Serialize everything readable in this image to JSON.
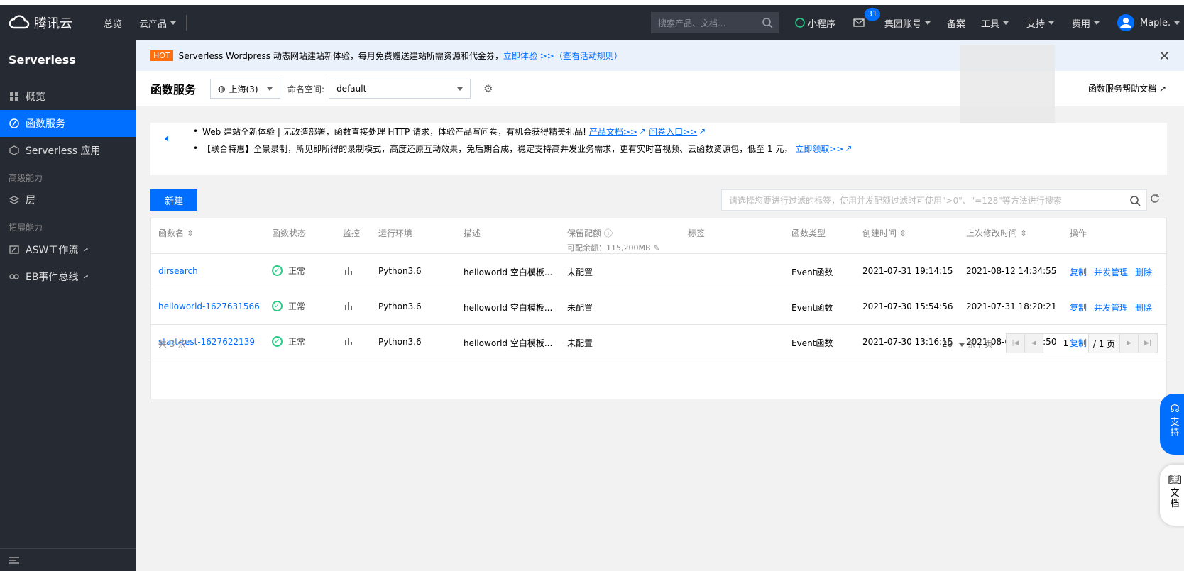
{
  "topbar": {
    "logo_text": "腾讯云",
    "nav": [
      "总览",
      "云产品"
    ],
    "search_placeholder": "搜索产品、文档...",
    "mini_program": "小程序",
    "mail_count": "31",
    "group_account": "集团账号",
    "beian": "备案",
    "tools": "工具",
    "support": "支持",
    "billing": "费用",
    "user": "Maple."
  },
  "sidebar": {
    "title": "Serverless",
    "items": [
      {
        "label": "概览",
        "icon": "grid-icon"
      },
      {
        "label": "函数服务",
        "icon": "function-icon"
      },
      {
        "label": "Serverless 应用",
        "icon": "app-icon"
      }
    ],
    "group_advanced": "高级能力",
    "layer": "层",
    "group_extend": "拓展能力",
    "asw": "ASW工作流",
    "eb": "EB事件总线"
  },
  "banner": {
    "hot": "HOT",
    "text": "Serverless Wordpress 动态网站建站新体验，每月免费赠送建站所需资源和代金券，",
    "link1": "立即体验 >>",
    "link2": "（查看活动规则）"
  },
  "header": {
    "title": "函数服务",
    "region": "上海(3)",
    "namespace_label": "命名空间:",
    "namespace": "default",
    "help": "函数服务帮助文档"
  },
  "notice": {
    "line1_text": "Web 建站全新体验 | 无改造部署，函数直接处理 HTTP 请求，体验产品写问卷，有机会获得精美礼品!",
    "line1_link1": "产品文档>>",
    "line1_link2": "问卷入口>>",
    "line2_text": "【联合特惠】全景录制，所见即所得的录制模式，高度还原互动效果，免后期合成，稳定支持高并发业务需求，更有实时音视频、云函数资源包，低至 1 元，",
    "line2_link": "立即领取>>"
  },
  "toolbar": {
    "new_label": "新建",
    "filter_placeholder": "请选择您要进行过滤的标签，使用并发配额过滤时可使用\">0\"、\"=128\"等方法进行搜索"
  },
  "table": {
    "headers": {
      "name": "函数名",
      "status": "函数状态",
      "monitor": "监控",
      "runtime": "运行环境",
      "desc": "描述",
      "quota": "保留配额",
      "quota_sub": "可配余额：115,200MB",
      "tags": "标签",
      "type": "函数类型",
      "created": "创建时间",
      "modified": "上次修改时间",
      "ops": "操作"
    },
    "rows": [
      {
        "name": "dirsearch",
        "status": "正常",
        "runtime": "Python3.6",
        "desc": "helloworld 空白模板...",
        "quota": "未配置",
        "type": "Event函数",
        "created": "2021-07-31 19:14:15",
        "modified": "2021-08-12 14:34:55"
      },
      {
        "name": "helloworld-1627631566",
        "status": "正常",
        "runtime": "Python3.6",
        "desc": "helloworld 空白模板...",
        "quota": "未配置",
        "type": "Event函数",
        "created": "2021-07-30 15:54:56",
        "modified": "2021-07-31 18:20:21"
      },
      {
        "name": "start-test-1627622139",
        "status": "正常",
        "runtime": "Python3.6",
        "desc": "helloworld 空白模板...",
        "quota": "未配置",
        "type": "Event函数",
        "created": "2021-07-30 13:16:15",
        "modified": "2021-08-02 21:07:50"
      }
    ],
    "ops": {
      "copy": "复制",
      "concurrency": "并发管理",
      "delete": "删除"
    }
  },
  "pager": {
    "total": "共 3 条",
    "size": "20",
    "size_unit": "条 / 页",
    "page": "1",
    "pages": "/ 1 页"
  },
  "float": {
    "support": [
      "支",
      "持"
    ],
    "doc": [
      "文",
      "档"
    ]
  },
  "colors": {
    "accent": "#006eff",
    "topbar": "#262a33",
    "ok": "#29cc85",
    "hot": "#ff6f0f"
  }
}
